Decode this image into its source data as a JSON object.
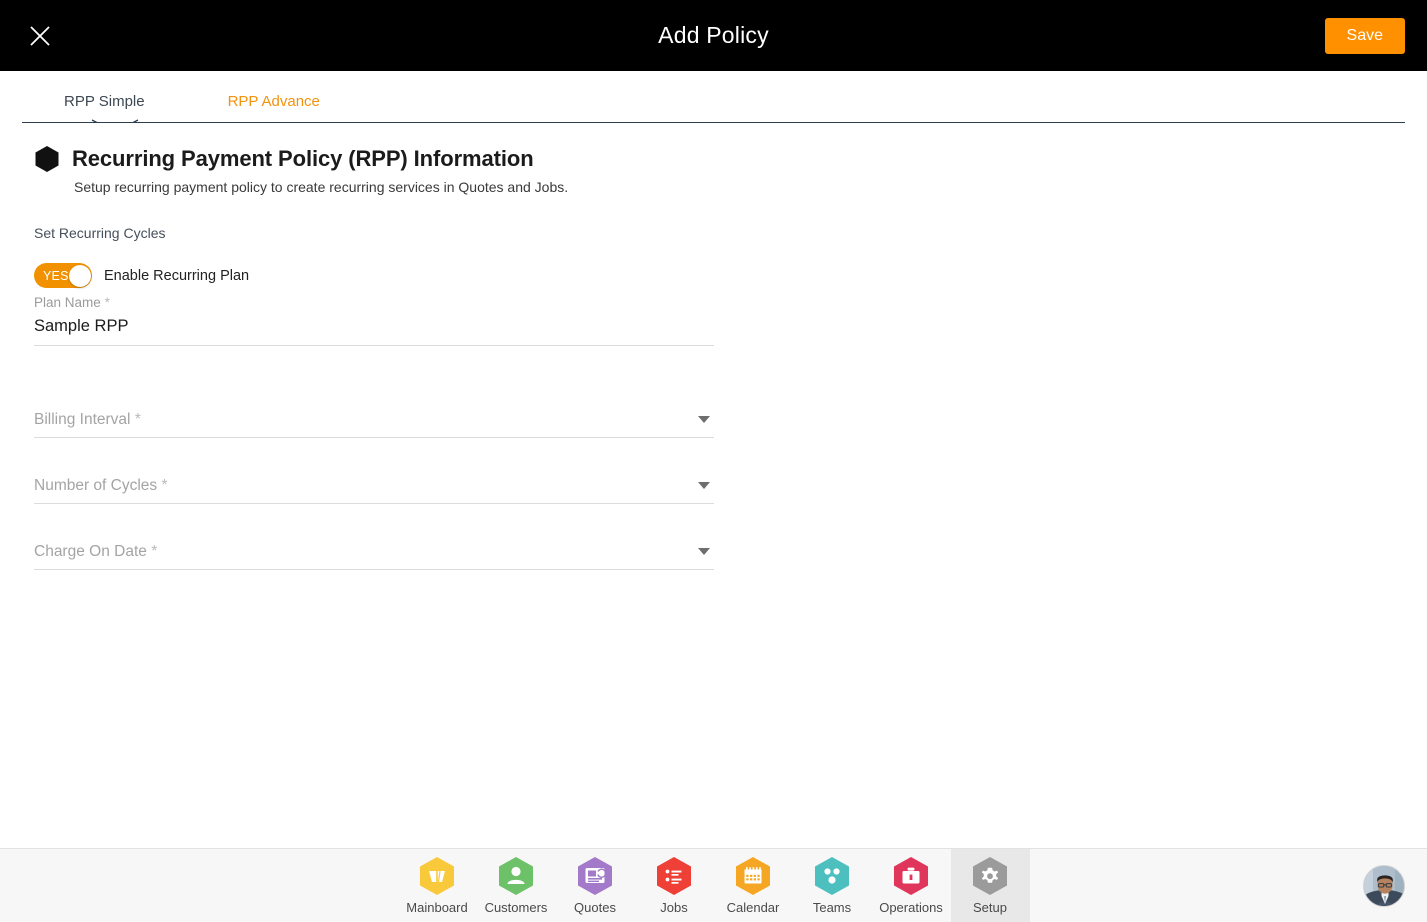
{
  "topbar": {
    "close_icon": "close-icon",
    "title": "Add Policy",
    "save_label": "Save",
    "accent_color": "#FF9100",
    "background_color": "#000000"
  },
  "tabs": [
    {
      "label": "RPP Simple",
      "active": true
    },
    {
      "label": "RPP Advance",
      "active": false,
      "color": "#F2930D"
    }
  ],
  "section": {
    "bullet_icon": "hexagon-icon",
    "title": "Recurring Payment Policy (RPP) Information",
    "subtitle": "Setup recurring payment policy to create recurring services in Quotes and Jobs.",
    "group_label": "Set Recurring Cycles"
  },
  "toggle": {
    "state_label": "YES",
    "caption": "Enable Recurring Plan",
    "on_color": "#F29100",
    "enabled": true
  },
  "fields": {
    "plan_name": {
      "label": "Plan Name",
      "required_mark": "*",
      "value": "Sample RPP",
      "placeholder": "Plan Name"
    },
    "billing_interval": {
      "label": "Billing Interval",
      "required_mark": "*",
      "value": "",
      "caret_icon": "chevron-down-icon"
    },
    "number_of_cycles": {
      "label": "Number of Cycles",
      "required_mark": "*",
      "value": "",
      "caret_icon": "chevron-down-icon"
    },
    "charge_on_date": {
      "label": "Charge On Date",
      "required_mark": "*",
      "value": "",
      "caret_icon": "chevron-down-icon"
    }
  },
  "bottom_nav": {
    "items": [
      {
        "label": "Mainboard",
        "icon": "mainboard-icon",
        "color": "#F8C93B",
        "active": false
      },
      {
        "label": "Customers",
        "icon": "customers-icon",
        "color": "#6DC269",
        "active": false
      },
      {
        "label": "Quotes",
        "icon": "quotes-icon",
        "color": "#A379C9",
        "active": false
      },
      {
        "label": "Jobs",
        "icon": "jobs-icon",
        "color": "#EE4036",
        "active": false
      },
      {
        "label": "Calendar",
        "icon": "calendar-icon",
        "color": "#F5A623",
        "active": false
      },
      {
        "label": "Teams",
        "icon": "teams-icon",
        "color": "#4EBFBF",
        "active": false
      },
      {
        "label": "Operations",
        "icon": "operations-icon",
        "color": "#E0365C",
        "active": false
      },
      {
        "label": "Setup",
        "icon": "gear-icon",
        "color": "#9B9B9B",
        "active": true
      }
    ],
    "avatar": "user-avatar",
    "background_color": "#F7F7F7",
    "active_background_color": "#E8E8E8"
  }
}
